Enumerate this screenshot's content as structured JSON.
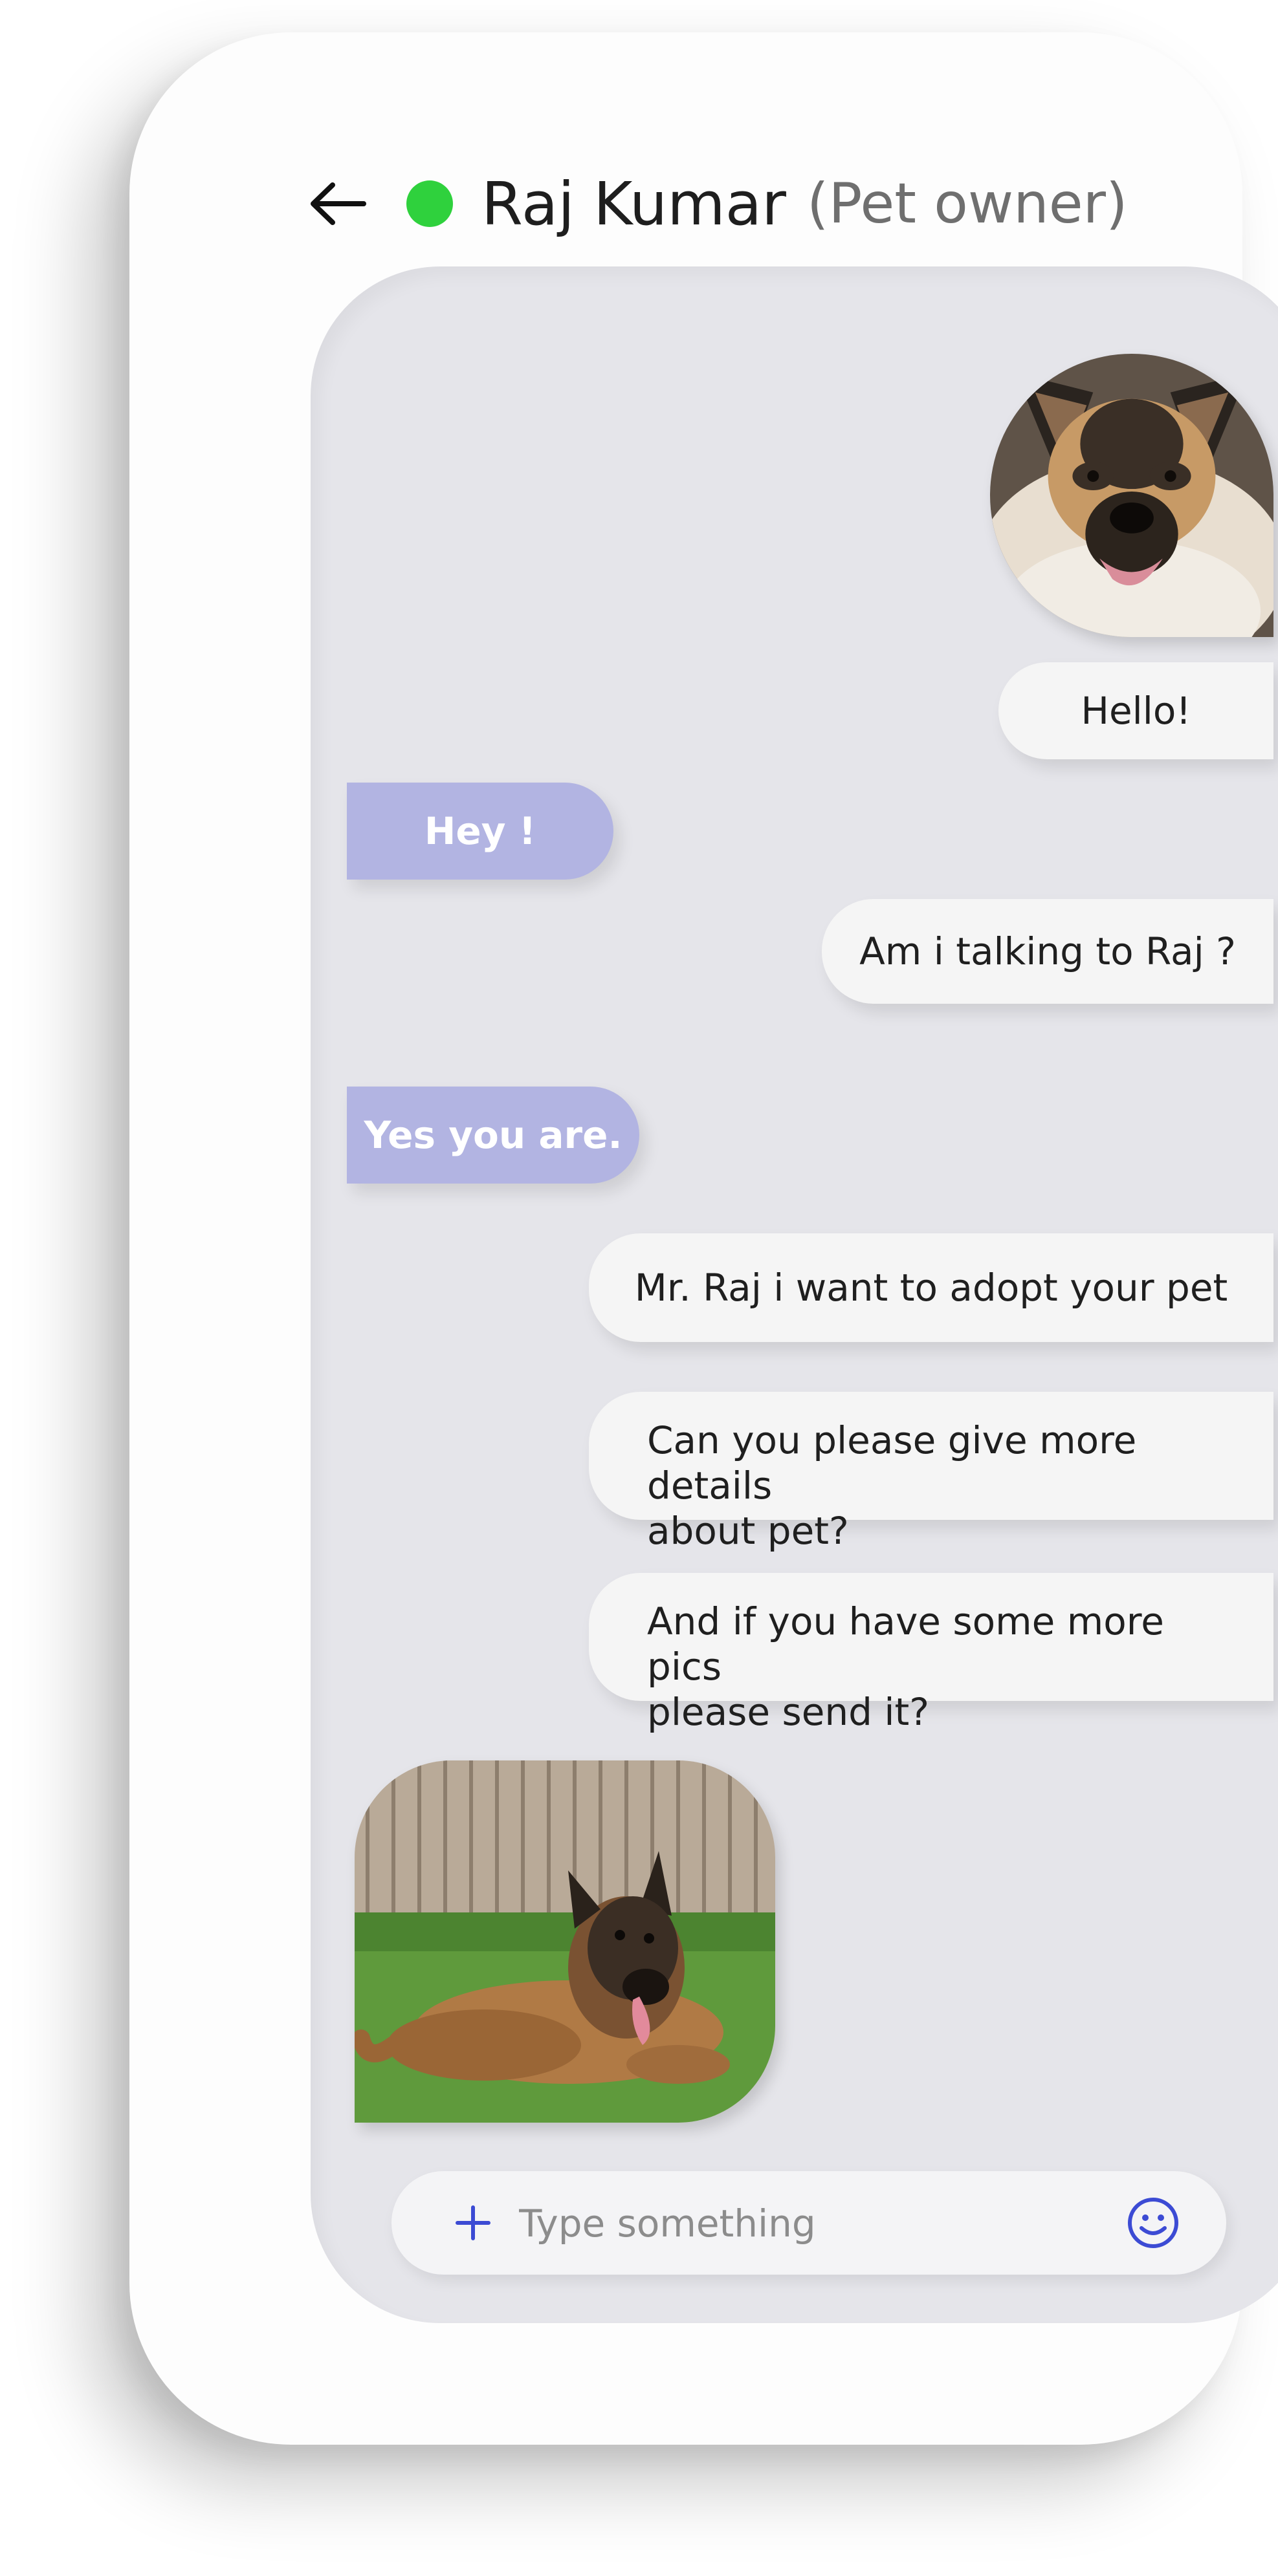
{
  "header": {
    "back_icon": "arrow-left-icon",
    "status_icon": "online-dot",
    "name": "Raj Kumar",
    "role": "(Pet owner)"
  },
  "colors": {
    "online": "#2fd13d",
    "accent": "#3c4bd4",
    "incoming_bubble": "#b2b4e2",
    "outgoing_bubble": "#f5f5f5",
    "chat_background": "#e5e5ea"
  },
  "messages": [
    {
      "type": "image",
      "direction": "outgoing",
      "content": "german-shepherd-portrait"
    },
    {
      "type": "text",
      "direction": "outgoing",
      "text": "Hello!"
    },
    {
      "type": "text",
      "direction": "incoming",
      "text": "Hey !"
    },
    {
      "type": "text",
      "direction": "outgoing",
      "text": "Am i talking to Raj ?"
    },
    {
      "type": "text",
      "direction": "incoming",
      "text": "Yes you are."
    },
    {
      "type": "text",
      "direction": "outgoing",
      "text": "Mr. Raj i want to adopt your pet"
    },
    {
      "type": "text",
      "direction": "outgoing",
      "text": "Can you please give more details\nabout pet?"
    },
    {
      "type": "text",
      "direction": "outgoing",
      "text": "And if you have some more pics\nplease send it?"
    },
    {
      "type": "image",
      "direction": "incoming",
      "content": "german-shepherd-lying-on-grass"
    }
  ],
  "composer": {
    "attach_icon": "plus-icon",
    "placeholder": "Type something",
    "value": "",
    "emoji_icon": "smiley-icon"
  }
}
